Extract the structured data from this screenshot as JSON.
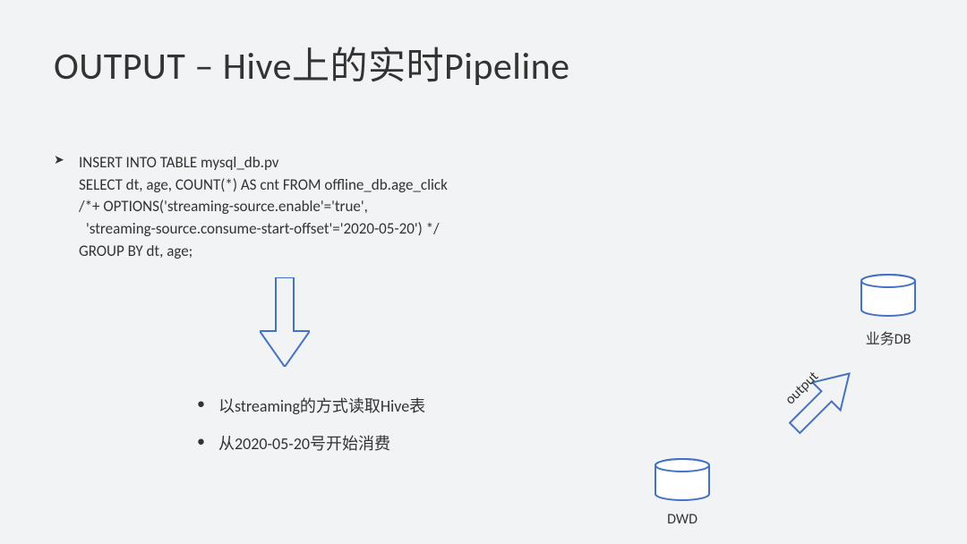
{
  "title": "OUTPUT – Hive上的实时Pipeline",
  "code": {
    "l1": "INSERT INTO TABLE mysql_db.pv",
    "l2": "SELECT dt, age, COUNT(*) AS cnt FROM offline_db.age_click",
    "l3": "/*+ OPTIONS('streaming-source.enable'='true',",
    "l4": " 'streaming-source.consume-start-offset'='2020-05-20') */",
    "l5": "GROUP BY dt, age;"
  },
  "bullets": {
    "b1": "以streaming的方式读取Hive表",
    "b2": "从2020-05-20号开始消费"
  },
  "diagram": {
    "dwd_label": "DWD",
    "biz_label": "业务DB",
    "arrow_label": "output"
  },
  "stroke_color": "#4472c4"
}
